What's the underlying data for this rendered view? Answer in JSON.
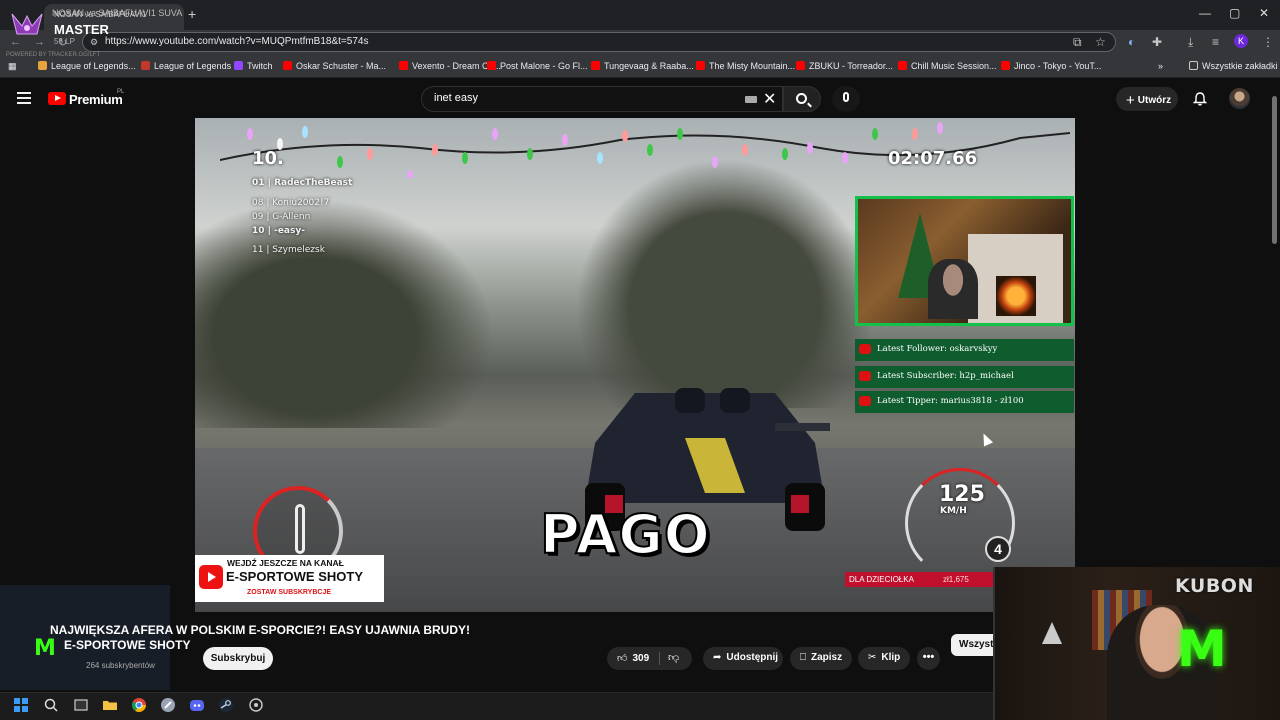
{
  "browser": {
    "tab_title": "NOSAN va SAIBAFUAVI1 SUVA",
    "url": "https://www.youtube.com/watch?v=MUQPmtfmB18&t=574s",
    "bookmarks": [
      {
        "label": "League of Legends...",
        "color": "#e6a33e"
      },
      {
        "label": "League of Legends",
        "color": "#c0392b"
      },
      {
        "label": "Twitch",
        "color": "#9146ff"
      },
      {
        "label": "Oskar Schuster - Ma...",
        "color": "#ff0000"
      },
      {
        "label": "Vexento - Dream Ca...",
        "color": "#ff0000"
      },
      {
        "label": "Post Malone - Go Fl...",
        "color": "#ff0000"
      },
      {
        "label": "Tungevaag & Raaba...",
        "color": "#ff0000"
      },
      {
        "label": "The Misty Mountain...",
        "color": "#ff0000"
      },
      {
        "label": "ZBUKU - Torreador...",
        "color": "#ff0000"
      },
      {
        "label": "Chill Music Session...",
        "color": "#ff0000"
      },
      {
        "label": "Jinco - Tokyo - YouT...",
        "color": "#ff0000"
      }
    ],
    "all_bookmarks": "Wszystkie zakładki",
    "profile_initial": "K"
  },
  "rank_overlay": {
    "tier": "MASTER",
    "lp": "56 LP",
    "summoner": "NOSAN va SAIBAFUAVI1",
    "tracker": "POWERED BY TRACKER.GG/LFT"
  },
  "youtube": {
    "brand": "Premium",
    "country": "PL",
    "search_query": "inet easy",
    "create_label": "Utwórz"
  },
  "video": {
    "race_position": "10.",
    "leaderboard": [
      {
        "text": "01 | RadecTheBeast"
      },
      {
        "text": "08 | Koniu2002!7"
      },
      {
        "text": "09 | G-Allenn"
      },
      {
        "text": "10 | -easy-"
      },
      {
        "text": "11 | Szymelezsk"
      }
    ],
    "timer": "02:07.66",
    "alerts": [
      "Latest Follower: oskarvskyy",
      "Latest Subscriber: h2p_michael",
      "Latest Tipper: marius3818 - zł100"
    ],
    "speed": "125",
    "speed_unit": "KM/H",
    "gear": "4",
    "caption": "PAGO",
    "donation_label": "DLA DZIECIOŁKA",
    "donation_amount": "zł1,675",
    "promo_top": "WEJDŹ JESZCZE NA KANAŁ",
    "promo_main": "E-SPORTOWE SHOTY",
    "promo_bottom": "ZOSTAW SUBSKRYBCJE"
  },
  "meta": {
    "title": "NAJWIĘKSZA AFERA W POLSKIM E-SPORCIE?! EASY UJAWNIA BRUDY!",
    "channel": "E-SPORTOWE SHOTY",
    "subscribers": "264 subskrybentów",
    "subscribe_label": "Subskrybuj",
    "likes": "309",
    "share_label": "Udostępnij",
    "save_label": "Zapisz",
    "clip_label": "Klip",
    "chip_label": "Wszystkie",
    "more_label": "•••"
  },
  "webcam": {
    "overlay_name": "KUBON"
  }
}
